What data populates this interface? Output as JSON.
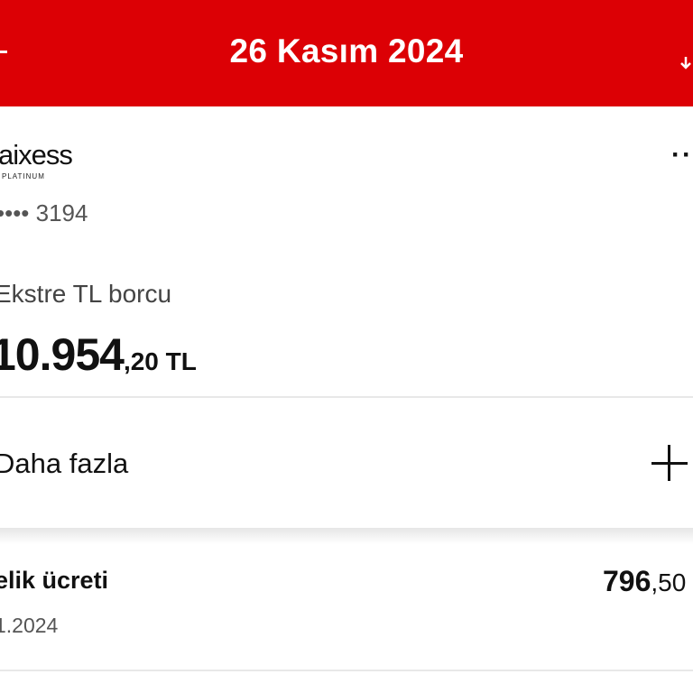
{
  "header": {
    "title": "26 Kasım 2024",
    "background_color": "#dc0005",
    "left_icon": "back-arrow-icon",
    "right_icon": "download-icon"
  },
  "card": {
    "logo_text": "aixess",
    "logo_subtext": "PLATINUM",
    "masked_number": "•••• 3194",
    "more_icon": "more-dots-icon",
    "more_label": "···",
    "statement_label": "Ekstre TL borcu",
    "amount_main": "10.954",
    "amount_decimal": ",20 TL"
  },
  "more_section": {
    "label": "Daha fazla",
    "icon": "plus-icon"
  },
  "transactions": [
    {
      "name": "elik ücreti",
      "date": "1.2024",
      "amount_main": "796",
      "amount_decimal": ",50"
    }
  ]
}
